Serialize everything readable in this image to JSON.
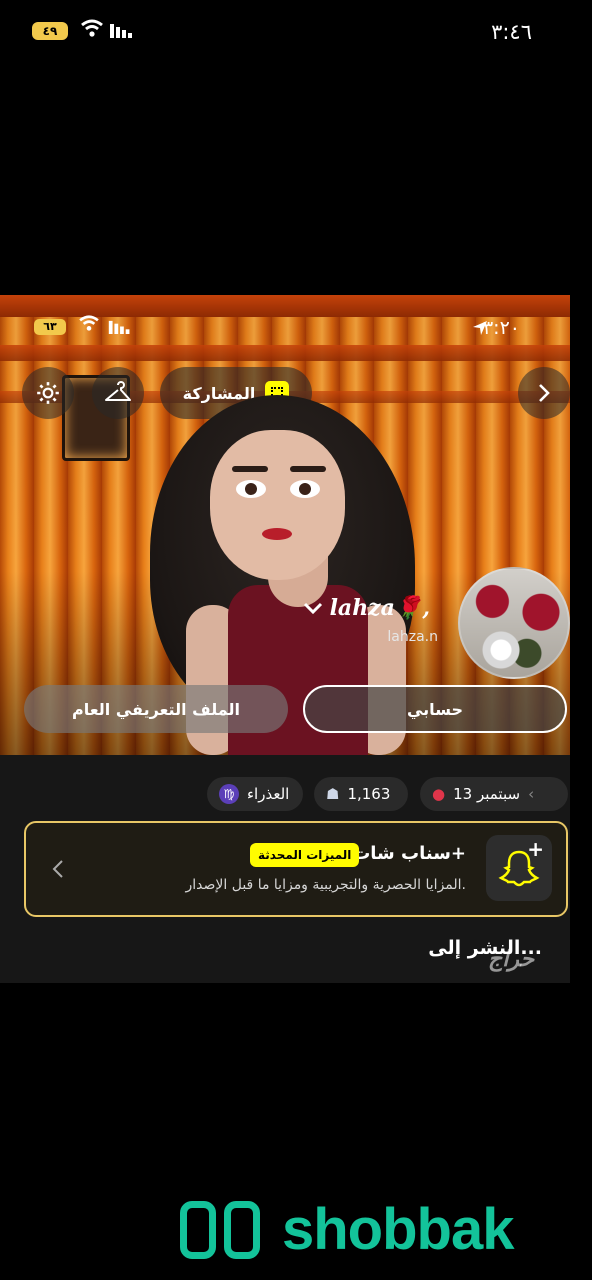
{
  "status_bar": {
    "time": "٣:٤٦",
    "battery": "٤٩"
  },
  "inner_screenshot": {
    "status_bar": {
      "time": "٣:٢٠",
      "battery": "٦٣"
    },
    "share_label": "المشاركة",
    "profile": {
      "display_name": "lahza🌹,",
      "username": "lahza.n"
    },
    "tabs": [
      {
        "label": "حسابي"
      },
      {
        "label": "الملف التعريفي العام"
      }
    ],
    "chips": {
      "birthday": "13 سبتمبر",
      "views": "1,163",
      "zodiac": "العذراء",
      "zodiac_symbol": "♍"
    },
    "snapchat_plus": {
      "title": "سناب شات+",
      "badge": "الميزات المحدثة",
      "description": "المزايا الحصرية والتجريبية ومزايا ما قبل الإصدار."
    },
    "post_to": "النشر إلى...",
    "watermark": "حراج"
  },
  "footer": {
    "brand": "shobbak",
    "brand_color": "#13c39a"
  },
  "colors": {
    "snap_yellow": "#fffc00",
    "card_border": "#e8c766"
  }
}
